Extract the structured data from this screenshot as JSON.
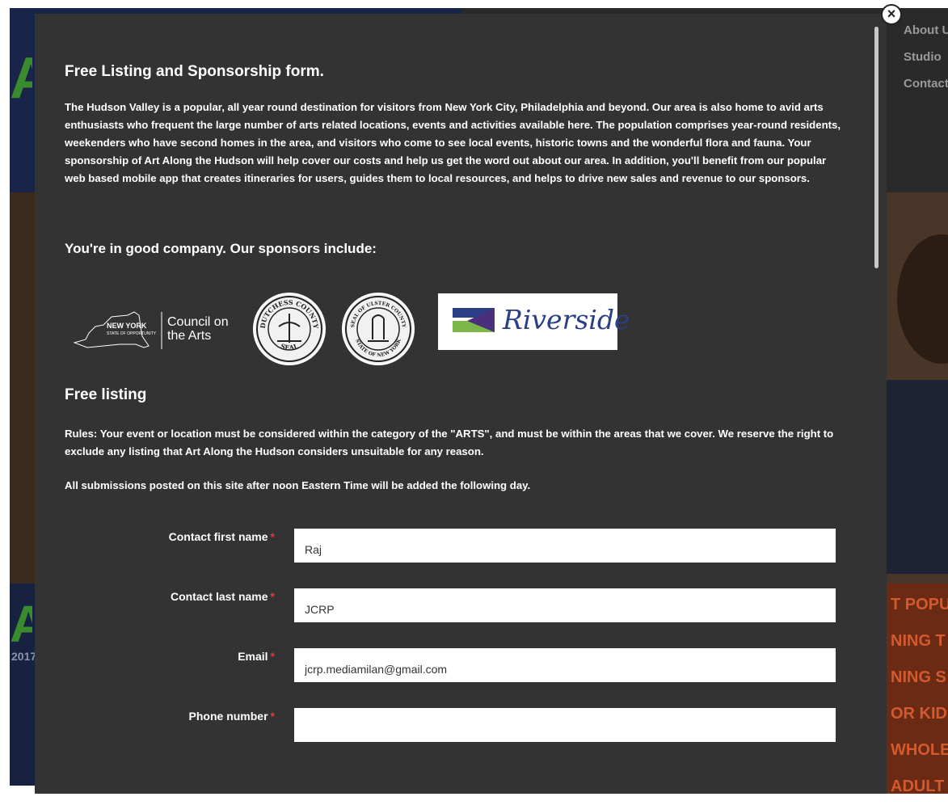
{
  "background": {
    "nav_items": [
      "About Us",
      "Studio",
      "Contact"
    ],
    "year_fragment": "2017",
    "category_fragments": [
      "T POPU",
      "NING T",
      "NING S",
      "OR KID",
      "WHOLE",
      "ADULT"
    ]
  },
  "modal": {
    "title": "Free Listing and Sponsorship form.",
    "intro": "The Hudson Valley is a popular, all year round destination for visitors from New York City, Philadelphia and beyond. Our area is also home to avid arts enthusiasts who frequent the large number of arts related locations, events and activities available here. The population comprises year-round residents, weekenders who have second homes in the area, and visitors who come to see local events, historic towns and the wonderful flora and fauna. Your sponsorship of Art Along the Hudson will help cover our costs and help us get the word out about our area. In addition, you'll benefit from our popular web based mobile app that creates itineraries for users, guides them to local resources, and helps to drive new sales and revenue to our sponsors.",
    "sponsors_heading": "You're in good company. Our sponsors include:",
    "sponsors": {
      "nysca_state": "NEW YORK",
      "nysca_state_sub": "STATE OF OPPORTUNITY",
      "nysca_name_line1": "Council on",
      "nysca_name_line2": "the Arts",
      "dutchess_seal_top": "DUTCHESS COUNTY",
      "dutchess_seal_bottom": "SEAL",
      "ulster_seal_top": "SEAL OF ULSTER COUNTY",
      "ulster_seal_bottom": "STATE OF NEW YORK",
      "riverside": "Riverside"
    },
    "free_listing_heading": "Free listing",
    "rules": "Rules: Your event or location must be considered within the category of the \"ARTS\", and must be within the areas that we cover. We reserve the right to exclude any listing that Art Along the Hudson considers unsuitable for any reason.",
    "submissions_note": "All submissions posted on this site after noon Eastern Time will be added the following day.",
    "close_glyph": "×"
  },
  "form": {
    "required_marker": "*",
    "fields": [
      {
        "label": "Contact first name",
        "value": "Raj"
      },
      {
        "label": "Contact last name",
        "value": "JCRP"
      },
      {
        "label": "Email",
        "value": "jcrp.mediamilan@gmail.com"
      },
      {
        "label": "Phone number",
        "value": ""
      }
    ]
  },
  "colors": {
    "modal_bg": "#333333",
    "required": "#e0393a",
    "riverside_blue": "#2b3f87",
    "riverside_green": "#7ab648"
  }
}
